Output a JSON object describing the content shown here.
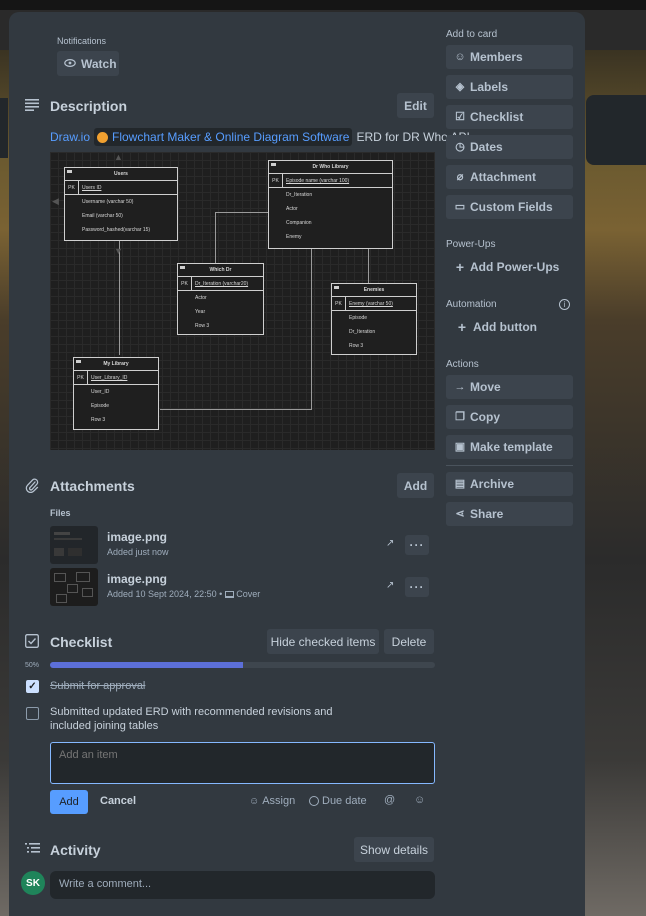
{
  "notifications": {
    "label": "Notifications",
    "watch_label": "Watch"
  },
  "description": {
    "title": "Description",
    "edit_label": "Edit",
    "link_drawio": "Draw.io",
    "link_card": "Flowchart Maker & Online Diagram Software",
    "text_after": "ERD for DR Who API"
  },
  "erd": {
    "users": {
      "title": "Users",
      "pk": "PK",
      "pk_field": "Users ID",
      "fields": [
        "Username (varchar 50)",
        "Email (varchar 50)",
        "Password_hashed(varchar 15)"
      ]
    },
    "drwho": {
      "title": "Dr Who Library",
      "pk": "PK",
      "pk_field": "Episode name (varchar 100)",
      "fields": [
        "Dr_Iteration",
        "Actor",
        "Companion",
        "Enemy"
      ]
    },
    "which": {
      "title": "Which Dr",
      "pk": "PK",
      "pk_field": "Dr_Iteration (varchar20)",
      "fields": [
        "Actor",
        "Year",
        "Row 3"
      ]
    },
    "enemies": {
      "title": "Enemies",
      "pk": "PK",
      "pk_field": "Enemy (varchar 50)",
      "fields": [
        "Episode",
        "Dr_Iteration",
        "Row 3"
      ]
    },
    "mylib": {
      "title": "My Library",
      "pk": "PK",
      "pk_field": "User_Library_ID",
      "fields": [
        "User_ID",
        "Episode",
        "Row 3"
      ]
    }
  },
  "attachments": {
    "title": "Attachments",
    "add_label": "Add",
    "files_label": "Files",
    "files": [
      {
        "name": "image.png",
        "meta": "Added just now",
        "cover": ""
      },
      {
        "name": "image.png",
        "meta": "Added 10 Sept 2024, 22:50 •",
        "cover": "Cover"
      }
    ]
  },
  "checklist": {
    "title": "Checklist",
    "hide_label": "Hide checked items",
    "delete_label": "Delete",
    "percent": "50%",
    "progress": 0.5,
    "items": [
      {
        "text": "Submit for approval",
        "checked": true
      },
      {
        "text": "Submitted updated ERD with recommended revisions and included joining tables",
        "checked": false
      }
    ],
    "add_placeholder": "Add an item",
    "add_label": "Add",
    "cancel_label": "Cancel",
    "assign_label": "Assign",
    "due_label": "Due date"
  },
  "activity": {
    "title": "Activity",
    "show_details_label": "Show details",
    "avatar_initials": "SK",
    "comment_placeholder": "Write a comment..."
  },
  "sidebar": {
    "add_to_card": "Add to card",
    "members": "Members",
    "labels": "Labels",
    "checklist": "Checklist",
    "dates": "Dates",
    "attachment": "Attachment",
    "custom_fields": "Custom Fields",
    "powerups_head": "Power-Ups",
    "add_powerups": "Add Power-Ups",
    "automation_head": "Automation",
    "add_button": "Add button",
    "actions_head": "Actions",
    "move": "Move",
    "copy": "Copy",
    "make_template": "Make template",
    "archive": "Archive",
    "share": "Share"
  },
  "colors": {
    "dialog_bg": "#323940",
    "button_bg": "#3c444d",
    "link": "#579dff",
    "primary": "#579dff",
    "progress": "#5c6fd8",
    "avatar": "#1f845a"
  }
}
